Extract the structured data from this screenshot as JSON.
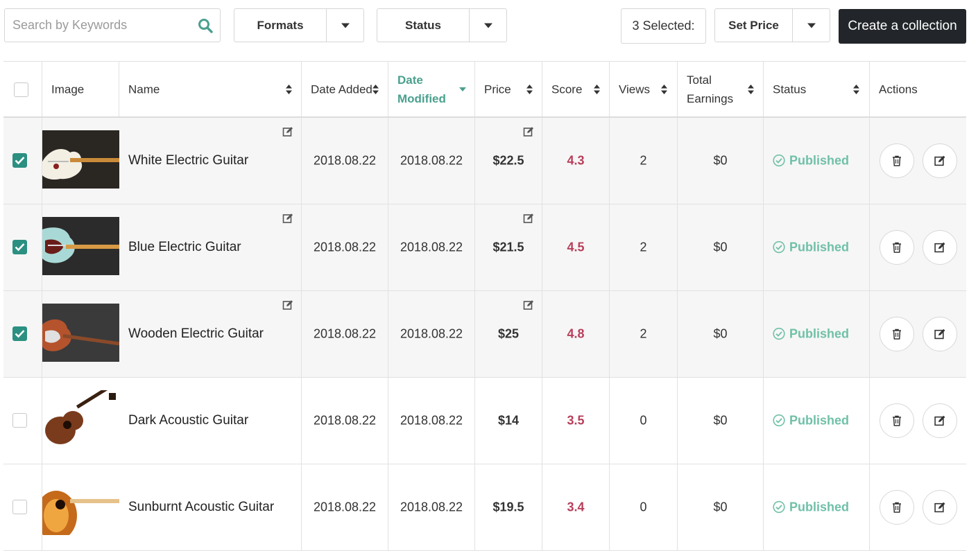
{
  "toolbar": {
    "search_placeholder": "Search by Keywords",
    "formats_label": "Formats",
    "status_label": "Status",
    "selected_text": "3 Selected:",
    "set_price_label": "Set Price",
    "create_collection_label": "Create a collection"
  },
  "colors": {
    "accent": "#4aa08e",
    "checkbox_checked": "#2b9081",
    "score": "#b83f5a",
    "published": "#70c0a8",
    "dark_button": "#22262a"
  },
  "table": {
    "headers": {
      "image": "Image",
      "name": "Name",
      "date_added": "Date Added",
      "date_modified_1": "Date",
      "date_modified_2": "Modified",
      "price": "Price",
      "score": "Score",
      "views": "Views",
      "earnings_1": "Total",
      "earnings_2": "Earnings",
      "status": "Status",
      "actions": "Actions"
    },
    "rows": [
      {
        "checked": true,
        "name": "White Electric Guitar",
        "date_added": "2018.08.22",
        "date_modified": "2018.08.22",
        "price": "$22.5",
        "score": "4.3",
        "views": "2",
        "earnings": "$0",
        "status": "Published",
        "image_icon": "white-electric-guitar-thumbnail"
      },
      {
        "checked": true,
        "name": "Blue Electric Guitar",
        "date_added": "2018.08.22",
        "date_modified": "2018.08.22",
        "price": "$21.5",
        "score": "4.5",
        "views": "2",
        "earnings": "$0",
        "status": "Published",
        "image_icon": "blue-electric-guitar-thumbnail"
      },
      {
        "checked": true,
        "name": "Wooden Electric Guitar",
        "date_added": "2018.08.22",
        "date_modified": "2018.08.22",
        "price": "$25",
        "score": "4.8",
        "views": "2",
        "earnings": "$0",
        "status": "Published",
        "image_icon": "wooden-electric-guitar-thumbnail"
      },
      {
        "checked": false,
        "name": "Dark Acoustic Guitar",
        "date_added": "2018.08.22",
        "date_modified": "2018.08.22",
        "price": "$14",
        "score": "3.5",
        "views": "0",
        "earnings": "$0",
        "status": "Published",
        "image_icon": "dark-acoustic-guitar-thumbnail"
      },
      {
        "checked": false,
        "name": "Sunburnt Acoustic Guitar",
        "date_added": "2018.08.22",
        "date_modified": "2018.08.22",
        "price": "$19.5",
        "score": "3.4",
        "views": "0",
        "earnings": "$0",
        "status": "Published",
        "image_icon": "sunburnt-acoustic-guitar-thumbnail"
      }
    ]
  }
}
